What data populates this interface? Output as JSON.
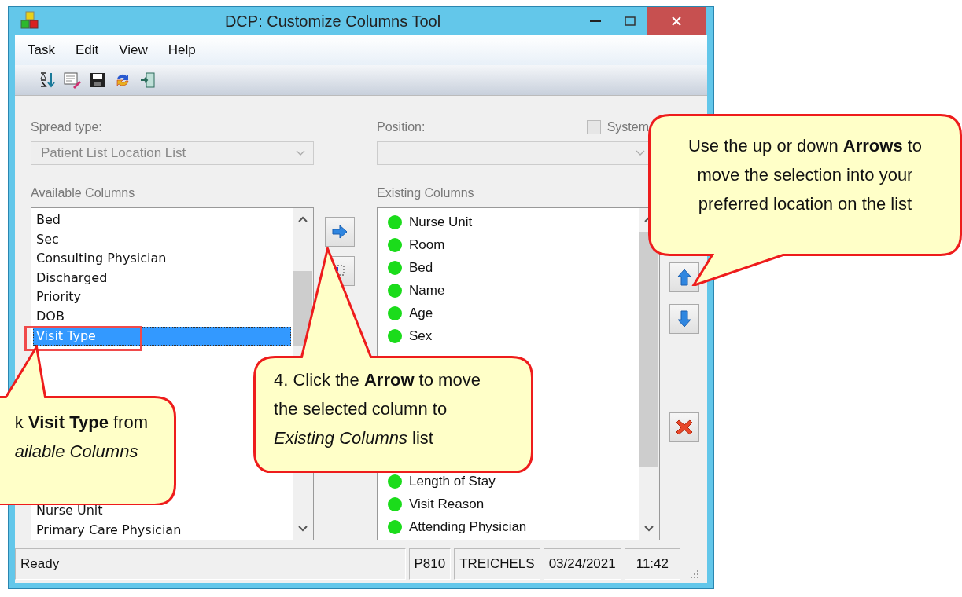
{
  "window": {
    "title": "DCP: Customize Columns Tool"
  },
  "menu": [
    "Task",
    "Edit",
    "View",
    "Help"
  ],
  "spread_type": {
    "label": "Spread type:",
    "value": "Patient List Location List",
    "disabled": true
  },
  "position": {
    "label": "Position:",
    "disabled": true
  },
  "system_checkbox": {
    "label": "System",
    "checked": false,
    "disabled": true
  },
  "available_columns": {
    "label": "Available Columns",
    "items_top": [
      {
        "text": "Bed",
        "selected": false
      },
      {
        "text": "Sec",
        "selected": false
      },
      {
        "text": "Consulting Physician",
        "selected": false
      },
      {
        "text": "Discharged",
        "selected": false
      },
      {
        "text": "Priority",
        "selected": false
      },
      {
        "text": "DOB",
        "selected": false
      },
      {
        "text": "Visit Type",
        "selected": true
      }
    ],
    "items_bottom": [
      {
        "text": "Nurse Unit",
        "selected": false
      },
      {
        "text": "Primary Care Physician",
        "selected": false
      }
    ]
  },
  "existing_columns": {
    "label": "Existing Columns",
    "items_top": [
      "Nurse Unit",
      "Room",
      "Bed",
      "Name",
      "Age",
      "Sex"
    ],
    "items_bottom": [
      "Length of Stay",
      "Visit Reason",
      "Attending Physician"
    ]
  },
  "status_bar": [
    "Ready",
    "P810",
    "TREICHELS",
    "03/24/2021",
    "11:42"
  ],
  "callouts": [
    {
      "lines": [
        "Use the up or down **Arrows** to",
        "move the selection into your",
        "preferred location on the list"
      ]
    },
    {
      "lines": [
        "4. Click the **Arrow** to move",
        "the selected column to",
        "*Existing Columns* list"
      ]
    },
    {
      "lines": [
        "k **Visit Type** from",
        "*ailable Columns*"
      ]
    }
  ]
}
